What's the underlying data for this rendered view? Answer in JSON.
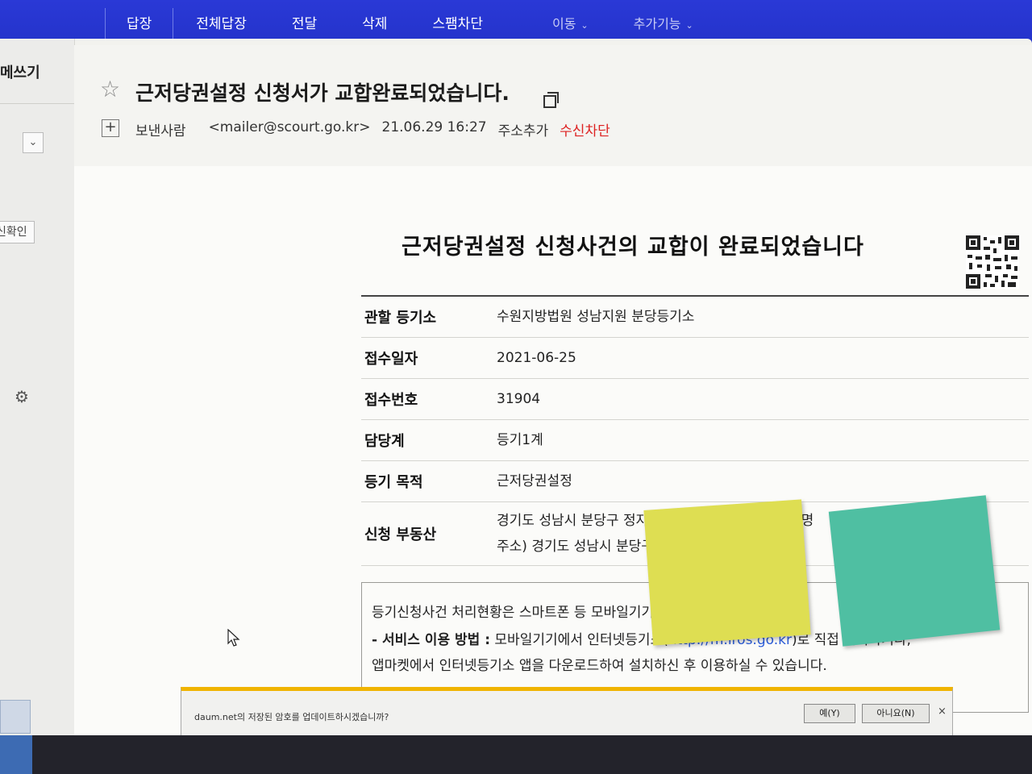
{
  "toolbar": {
    "reply": "답장",
    "reply_all": "전체답장",
    "forward": "전달",
    "delete": "삭제",
    "spam_block": "스팸차단",
    "move": "이동",
    "more": "추가기능",
    "caret": "⌄"
  },
  "sidebar": {
    "compose": "메쓰기",
    "confirm": "신확인"
  },
  "message": {
    "subject": "근저당권설정 신청서가 교합완료되었습니다.",
    "sender_label": "보낸사람",
    "sender_email": "<mailer@scourt.go.kr>",
    "datetime": "21.06.29 16:27",
    "add_address": "주소추가",
    "block_sender": "수신차단"
  },
  "body": {
    "title": "근저당권설정 신청사건의 교합이 완료되었습니다",
    "rows": [
      {
        "label": "관할 등기소",
        "value": "수원지방법원 성남지원 분당등기소"
      },
      {
        "label": "접수일자",
        "value": "2021-06-25"
      },
      {
        "label": "접수번호",
        "value": "31904"
      },
      {
        "label": "담당계",
        "value": "등기1계"
      },
      {
        "label": "등기 목적",
        "value": "근저당권설정"
      }
    ],
    "property_label": "신청 부동산",
    "property_line1": "경기도 성남시 분당구 정자동 24 분당일대지지2 도로명",
    "property_line2": "주소) 경기도 성남시 분당구",
    "info_line1": "등기신청사건 처리현황은 스마트폰 등 모바일기기에서도 조회",
    "info_line2_bold": "- 서비스 이용 방법 :",
    "info_line2_text": " 모바일기기에서 인터넷등기소(",
    "info_link": "http://m.iros.go.kr",
    "info_line2_end": ")로 직접 접속하거나,",
    "info_line3": "앱마켓에서 인터넷등기소 앱을 다운로드하여 설치하신 후 이용하실 수 있습니다."
  },
  "notification": {
    "text": "daum.net의 저장된 암호를 업데이트하시겠습니까?",
    "yes": "예(Y)",
    "no": "아니요(N)",
    "close": "×"
  },
  "colors": {
    "toolbar": "#1f2ec2",
    "block_link": "#dd2222",
    "sticky_yellow": "#dede52",
    "sticky_teal": "#4fbfa2",
    "notify_accent": "#f0b400"
  }
}
